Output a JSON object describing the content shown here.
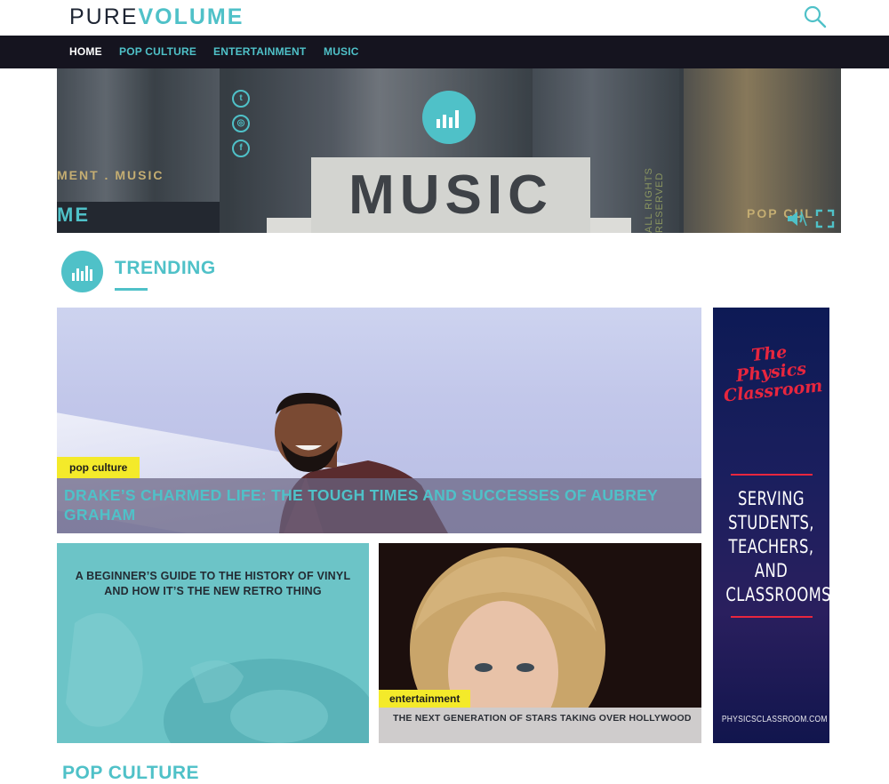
{
  "brand": {
    "logo_part1": "PURE",
    "logo_part2": "VOLUME",
    "accent": "#4fc1c8",
    "nav_bg": "#15141f"
  },
  "header": {
    "search_icon": "search-icon"
  },
  "nav": {
    "items": [
      {
        "label": "HOME",
        "active": true
      },
      {
        "label": "POP CULTURE",
        "active": false
      },
      {
        "label": "ENTERTAINMENT",
        "active": false
      },
      {
        "label": "MUSIC",
        "active": false
      }
    ]
  },
  "hero": {
    "main_text": "MUSIC",
    "left_text": "MENT . MUSIC",
    "left_text2": "ME",
    "side_text": "ALL RIGHTS RESERVED",
    "right_text": "POP CUL",
    "social_icons": [
      "twitter-icon",
      "instagram-icon",
      "facebook-icon"
    ],
    "controls": [
      "volume-icon",
      "fullscreen-icon"
    ]
  },
  "trending": {
    "heading": "TRENDING",
    "featured": {
      "tag": "pop culture",
      "title": "DRAKE’S CHARMED LIFE: THE TOUGH TIMES AND SUCCESSES OF AUBREY GRAHAM"
    },
    "cards": [
      {
        "title": "A BEGINNER’S GUIDE TO THE HISTORY OF VINYL AND HOW IT’S THE NEW RETRO THING"
      },
      {
        "tag": "entertainment",
        "title": "THE NEXT GENERATION OF STARS TAKING OVER HOLLYWOOD"
      }
    ]
  },
  "ad": {
    "brand_line1": "The",
    "brand_line2": "Physics",
    "brand_line3": "Classroom",
    "text_lines": [
      "SERVING",
      "STUDENTS,",
      "TEACHERS,",
      "AND",
      "CLASSROOMS"
    ],
    "url": "PHYSICSCLASSROOM.COM"
  },
  "next_section": {
    "heading": "POP CULTURE"
  }
}
